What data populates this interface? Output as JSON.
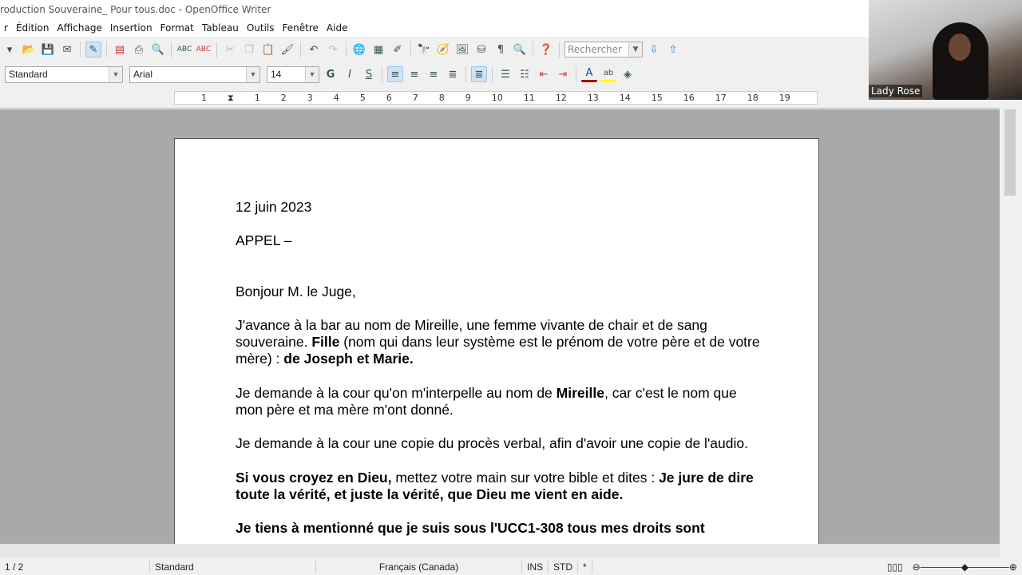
{
  "window": {
    "title": "roduction Souveraine_ Pour tous.doc - OpenOffice Writer"
  },
  "menu": [
    "r",
    "Édition",
    "Affichage",
    "Insertion",
    "Format",
    "Tableau",
    "Outils",
    "Fenêtre",
    "Aide"
  ],
  "toolbar": {
    "search_placeholder": "Rechercher"
  },
  "format_bar": {
    "style": "Standard",
    "font": "Arial",
    "size": "14",
    "bold": "G",
    "italic": "I",
    "underline": "S"
  },
  "ruler": [
    "1",
    "1",
    "2",
    "3",
    "4",
    "5",
    "6",
    "7",
    "8",
    "9",
    "10",
    "11",
    "12",
    "13",
    "14",
    "15",
    "16",
    "17",
    "18",
    "19"
  ],
  "document": {
    "date": "12 juin 2023",
    "heading": "APPEL –",
    "greeting": "Bonjour M. le Juge,",
    "p1a": "J'avance à la bar au nom de Mireille, une femme vivante de chair et de sang souveraine.  ",
    "p1b": "Fille",
    "p1c": " (nom qui dans leur système est le prénom de votre père et de votre mère) : ",
    "p1d": "de Joseph et Marie.",
    "p2a": "Je demande à la cour qu'on m'interpelle au nom de ",
    "p2b": "Mireille",
    "p2c": ", car c'est le nom que mon père et ma mère m'ont donné.",
    "p3": "Je demande à la cour une copie du procès verbal, afin d'avoir une copie de l'audio.",
    "p4a": "Si vous croyez en Dieu,",
    "p4b": " mettez votre main sur votre bible et dites :  ",
    "p4c": "Je jure de dire toute la vérité, et juste la vérité, que Dieu me vient en aide.",
    "p5": "Je tiens à mentionné que je suis sous l'UCC1-308 tous mes droits sont"
  },
  "status": {
    "page": "1 / 2",
    "style": "Standard",
    "language": "Français (Canada)",
    "mode": "INS",
    "selection": "STD",
    "modified": "*"
  },
  "video": {
    "name": "Lady Rose"
  }
}
